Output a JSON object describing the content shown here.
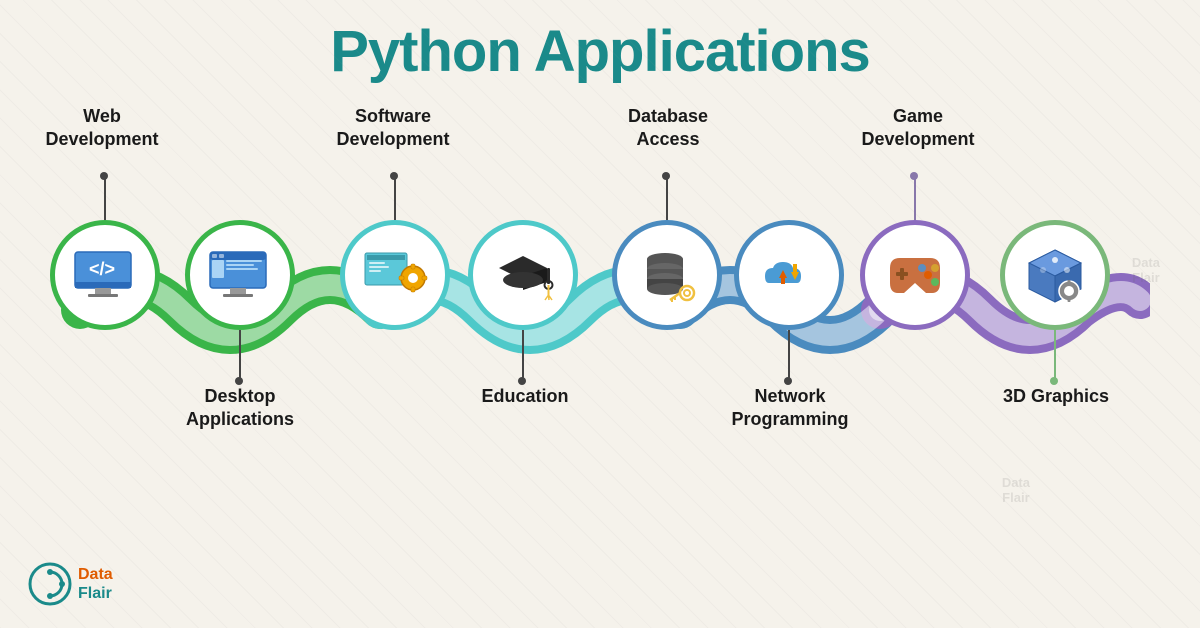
{
  "title": "Python Applications",
  "items": [
    {
      "id": "web-dev",
      "label_top": "Web\nDevelopment",
      "label_bottom": null,
      "position": "top",
      "color": "#3ab549",
      "icon": "web"
    },
    {
      "id": "desktop-apps",
      "label_top": null,
      "label_bottom": "Desktop\nApplications",
      "position": "bottom",
      "color": "#3ab549",
      "icon": "desktop"
    },
    {
      "id": "software-dev",
      "label_top": "Software\nDevelopment",
      "label_bottom": null,
      "position": "top",
      "color": "#4ec9c9",
      "icon": "software"
    },
    {
      "id": "education",
      "label_top": null,
      "label_bottom": "Education",
      "position": "bottom",
      "color": "#4ec9c9",
      "icon": "education"
    },
    {
      "id": "database",
      "label_top": "Database\nAccess",
      "label_bottom": null,
      "position": "top",
      "color": "#4a8bbf",
      "icon": "database"
    },
    {
      "id": "network",
      "label_top": null,
      "label_bottom": "Network\nProgramming",
      "position": "bottom",
      "color": "#4a8bbf",
      "icon": "network"
    },
    {
      "id": "game-dev",
      "label_top": "Game\nDevelopment",
      "label_bottom": null,
      "position": "top",
      "color": "#8b6bbf",
      "icon": "game"
    },
    {
      "id": "3d-graphics",
      "label_top": null,
      "label_bottom": "3D Graphics",
      "position": "bottom",
      "color": "#7ab87a",
      "icon": "3d"
    }
  ],
  "brand": {
    "name1": "Data",
    "name2": "Flair"
  }
}
